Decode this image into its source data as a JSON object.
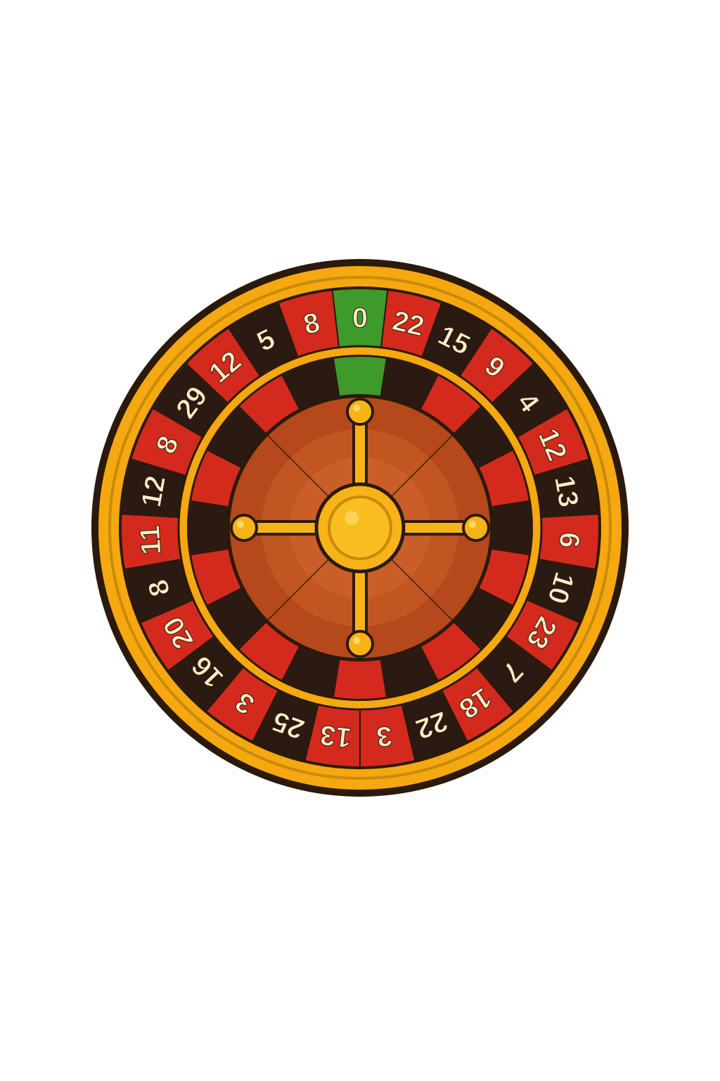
{
  "wheel": {
    "numbers": [
      {
        "label": "0",
        "color": "green"
      },
      {
        "label": "22",
        "color": "red"
      },
      {
        "label": "15",
        "color": "black"
      },
      {
        "label": "9",
        "color": "red"
      },
      {
        "label": "4",
        "color": "black"
      },
      {
        "label": "12",
        "color": "red"
      },
      {
        "label": "13",
        "color": "black"
      },
      {
        "label": "6",
        "color": "red"
      },
      {
        "label": "10",
        "color": "black"
      },
      {
        "label": "23",
        "color": "red"
      },
      {
        "label": "7",
        "color": "black"
      },
      {
        "label": "18",
        "color": "red"
      },
      {
        "label": "22",
        "color": "black"
      },
      {
        "label": "3",
        "color": "red"
      },
      {
        "label": "13",
        "color": "red"
      },
      {
        "label": "25",
        "color": "black"
      },
      {
        "label": "3",
        "color": "red"
      },
      {
        "label": "16",
        "color": "black"
      },
      {
        "label": "20",
        "color": "red"
      },
      {
        "label": "8",
        "color": "black"
      },
      {
        "label": "11",
        "color": "red"
      },
      {
        "label": "12",
        "color": "black"
      },
      {
        "label": "8",
        "color": "red"
      },
      {
        "label": "29",
        "color": "black"
      },
      {
        "label": "12",
        "color": "red"
      },
      {
        "label": "5",
        "color": "black"
      },
      {
        "label": "8",
        "color": "red"
      }
    ],
    "colors": {
      "red": "#d42a1e",
      "black": "#2a1a12",
      "green": "#3e9a2a",
      "gold": "#f5a810",
      "gold_dark": "#c98a0a",
      "outline": "#2b1a0c",
      "number_text": "#f8eec8",
      "bowl": "#b5491c",
      "bowl_center": "#c65a24",
      "hub": "#f7b318"
    },
    "inner_pockets": 20
  }
}
